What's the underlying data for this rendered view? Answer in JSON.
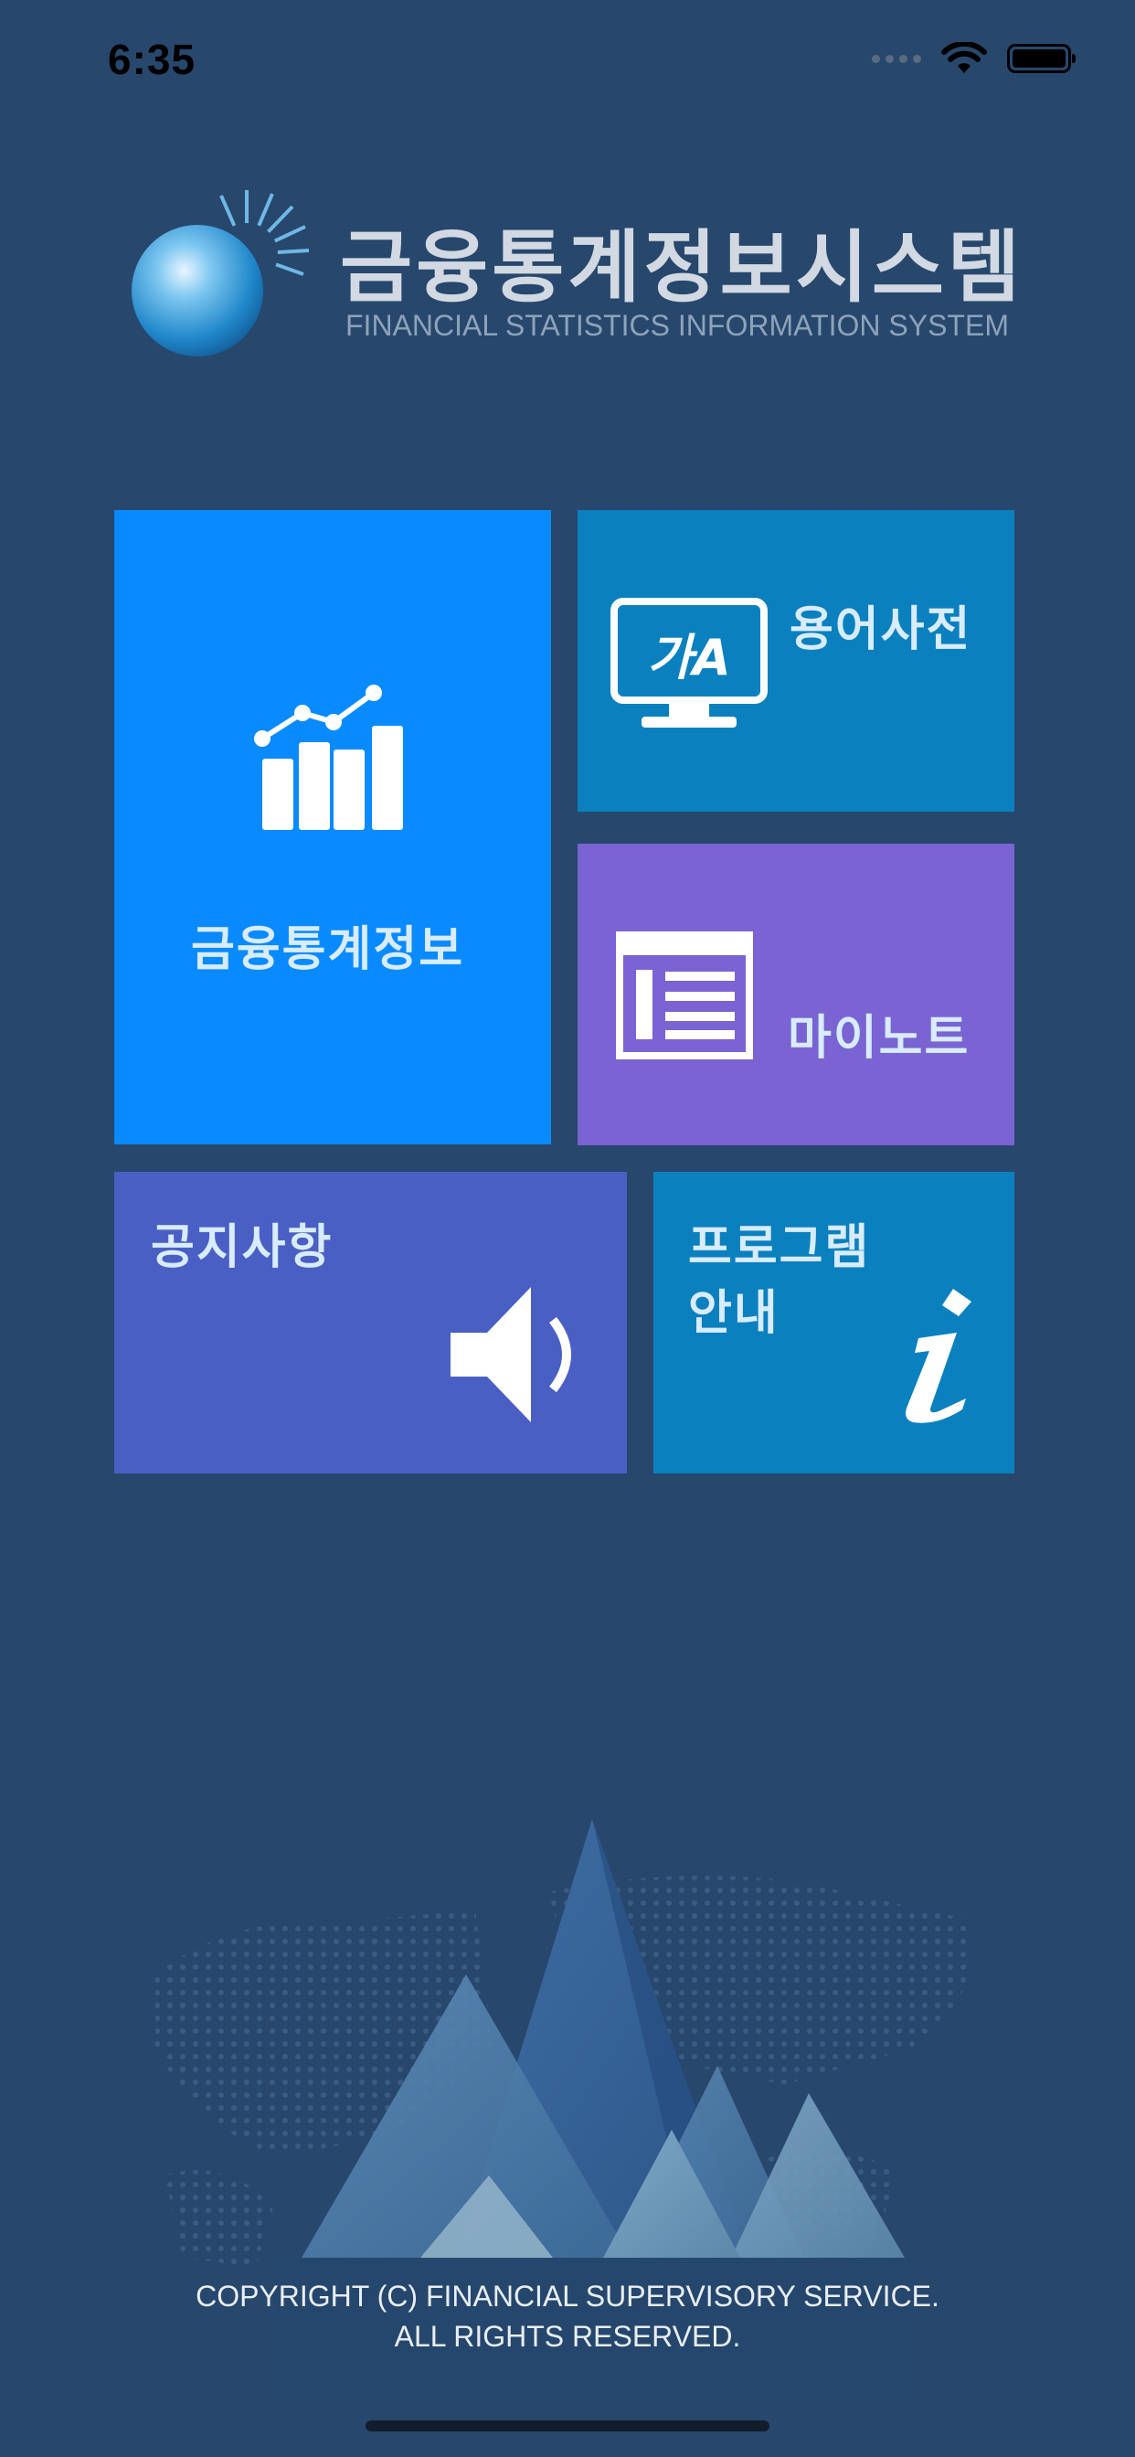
{
  "status_bar": {
    "time": "6:35"
  },
  "logo": {
    "title": "금융통계정보시스템",
    "subtitle": "FINANCIAL STATISTICS INFORMATION SYSTEM"
  },
  "tiles": {
    "stats": {
      "label": "금융통계정보",
      "icon": "bar-chart-icon",
      "color": "#0a8aff"
    },
    "dictionary": {
      "label": "용어사전",
      "icon": "dictionary-monitor-icon",
      "icon_text": "가A",
      "color": "#0b80bf"
    },
    "note": {
      "label": "마이노트",
      "icon": "notebook-icon",
      "color": "#7a63d2"
    },
    "notice": {
      "label": "공지사항",
      "icon": "speaker-icon",
      "color": "#4a5fc4"
    },
    "program": {
      "label_line1": "프로그램",
      "label_line2": "안내",
      "icon": "info-icon",
      "color": "#0b80bf"
    }
  },
  "footer": {
    "line1": "COPYRIGHT (C) FINANCIAL SUPERVISORY SERVICE.",
    "line2": "ALL RIGHTS RESERVED."
  }
}
